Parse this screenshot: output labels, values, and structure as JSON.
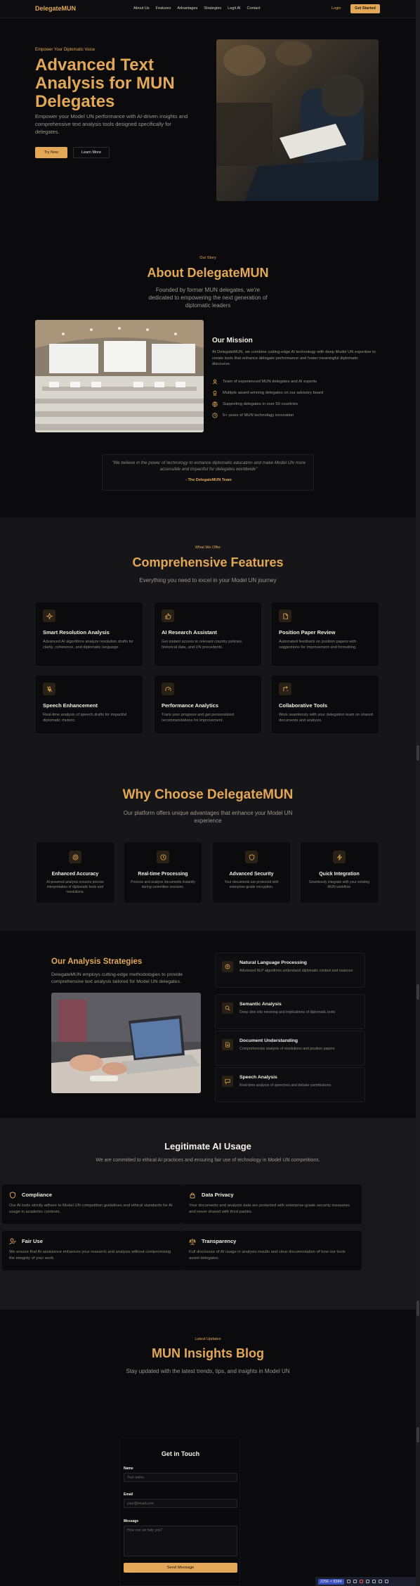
{
  "nav": {
    "brand": "DelegateMUN",
    "links": [
      "About Us",
      "Features",
      "Advantages",
      "Strategies",
      "Legit AI",
      "Contact"
    ],
    "login": "Login",
    "get_started": "Get Started"
  },
  "hero": {
    "eyebrow": "Empower Your Diplomatic Voice",
    "title": "Advanced Text Analysis for MUN Delegates",
    "subtitle": "Empower your Model UN performance with AI-driven insights and comprehensive text analysis tools designed specifically for delegates.",
    "try_now": "Try Now",
    "learn_more": "Learn More"
  },
  "about": {
    "eyebrow": "Our Story",
    "title": "About DelegateMUN",
    "subtitle": "Founded by former MUN delegates, we're dedicated to empowering the next generation of diplomatic leaders",
    "mission_title": "Our Mission",
    "mission_text": "At DelegateMUN, we combine cutting-edge AI technology with deep Model UN expertise to create tools that enhance delegate performance and foster meaningful diplomatic discourse.",
    "points": [
      {
        "icon": "team-icon",
        "text": "Team of experienced MUN delegates and AI experts"
      },
      {
        "icon": "award-icon",
        "text": "Multiple award-winning delegates on our advisory board"
      },
      {
        "icon": "globe-icon",
        "text": "Supporting delegates in over 50 countries"
      },
      {
        "icon": "clock-icon",
        "text": "5+ years of MUN technology innovation"
      }
    ],
    "quote": "\"We believe in the power of technology to enhance diplomatic education and make Model UN more accessible and impactful for delegates worldwide\"",
    "quote_author": "- The DelegateMUN Team"
  },
  "features": {
    "eyebrow": "What We Offer",
    "title": "Comprehensive Features",
    "subtitle": "Everything you need to excel in your Model UN journey",
    "cards": [
      {
        "icon": "sparkle-icon",
        "title": "Smart Resolution Analysis",
        "desc": "Advanced AI algorithms analyze resolution drafts for clarity, coherence, and diplomatic language."
      },
      {
        "icon": "thumbs-up-icon",
        "title": "AI Research Assistant",
        "desc": "Get instant access to relevant country policies, historical data, and UN precedents."
      },
      {
        "icon": "document-icon",
        "title": "Position Paper Review",
        "desc": "Automated feedback on position papers with suggestions for improvement and formatting."
      },
      {
        "icon": "mic-icon",
        "title": "Speech Enhancement",
        "desc": "Real-time analysis of speech drafts for impactful diplomatic rhetoric."
      },
      {
        "icon": "gauge-icon",
        "title": "Performance Analytics",
        "desc": "Track your progress and get personalized recommendations for improvement."
      },
      {
        "icon": "share-icon",
        "title": "Collaborative Tools",
        "desc": "Work seamlessly with your delegation team on shared documents and analysis."
      }
    ]
  },
  "why": {
    "title": "Why Choose DelegateMUN",
    "subtitle": "Our platform offers unique advantages that enhance your Model UN experience",
    "cards": [
      {
        "icon": "target-icon",
        "title": "Enhanced Accuracy",
        "desc": "AI-powered analysis ensures precise interpretation of diplomatic texts and resolutions."
      },
      {
        "icon": "clock-icon",
        "title": "Real-time Processing",
        "desc": "Process and analyze documents instantly during committee sessions."
      },
      {
        "icon": "shield-icon",
        "title": "Advanced Security",
        "desc": "Your documents are protected with enterprise-grade encryption."
      },
      {
        "icon": "lightning-icon",
        "title": "Quick Integration",
        "desc": "Seamlessly integrate with your existing MUN workflow."
      }
    ]
  },
  "strategies": {
    "title": "Our Analysis Strategies",
    "subtitle": "DelegateMUN employs cutting-edge methodologies to provide comprehensive text analysis tailored for Model UN delegates.",
    "items": [
      {
        "icon": "brain-icon",
        "title": "Natural Language Processing",
        "desc": "Advanced NLP algorithms understand diplomatic context and nuances"
      },
      {
        "icon": "search-icon",
        "title": "Semantic Analysis",
        "desc": "Deep dive into meaning and implications of diplomatic texts"
      },
      {
        "icon": "file-icon",
        "title": "Document Understanding",
        "desc": "Comprehensive analysis of resolutions and position papers"
      },
      {
        "icon": "chat-icon",
        "title": "Speech Analysis",
        "desc": "Real-time analysis of speeches and debate contributions"
      }
    ]
  },
  "legit": {
    "title": "Legitimate AI Usage",
    "subtitle": "We are committed to ethical AI practices and ensuring fair use of technology in Model UN competitions.",
    "cards": [
      {
        "icon": "shield-icon",
        "title": "Compliance",
        "desc": "Our AI tools strictly adhere to Model UN competition guidelines and ethical standards for AI usage in academic contexts."
      },
      {
        "icon": "lock-icon",
        "title": "Data Privacy",
        "desc": "Your documents and analysis data are protected with enterprise-grade security measures and never shared with third parties."
      },
      {
        "icon": "user-check-icon",
        "title": "Fair Use",
        "desc": "We ensure that AI assistance enhances your research and analysis without compromising the integrity of your work."
      },
      {
        "icon": "scales-icon",
        "title": "Transparency",
        "desc": "Full disclosure of AI usage in analysis results and clear documentation of how our tools assist delegates."
      }
    ]
  },
  "blog": {
    "eyebrow": "Latest Updates",
    "title": "MUN Insights Blog",
    "subtitle": "Stay updated with the latest trends, tips, and insights in Model UN"
  },
  "contact": {
    "title": "Get in Touch",
    "name_label": "Name",
    "name_placeholder": "Your name",
    "email_label": "Email",
    "email_placeholder": "your@email.com",
    "message_label": "Message",
    "message_placeholder": "How can we help you?",
    "send": "Send Message"
  },
  "taskbar": {
    "dimensions": "2256 × 8384"
  },
  "colors": {
    "accent": "#e3a857",
    "background": "#0b0b0d",
    "card": "#161618"
  }
}
